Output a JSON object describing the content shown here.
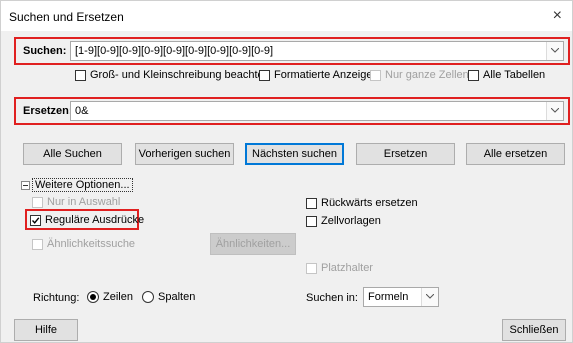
{
  "window": {
    "title": "Suchen und Ersetzen",
    "close_symbol": "×"
  },
  "search": {
    "label": "Suchen:",
    "value": "[1-9][0-9][0-9][0-9][0-9][0-9][0-9][0-9][0-9]"
  },
  "search_options": {
    "match_case": "Groß- und Kleinschreibung beachten",
    "formatted_display": "Formatierte Anzeige",
    "whole_cells": "Nur ganze Zellen",
    "all_sheets": "Alle Tabellen"
  },
  "replace": {
    "label": "Ersetzen:",
    "value": "0&"
  },
  "buttons": {
    "find_all": "Alle Suchen",
    "find_prev": "Vorherigen suchen",
    "find_next": "Nächsten suchen",
    "replace": "Ersetzen",
    "replace_all": "Alle ersetzen",
    "similarity_settings": "Ähnlichkeiten...",
    "help": "Hilfe",
    "close": "Schließen"
  },
  "more_options": {
    "toggle_label": "Weitere Optionen...",
    "current_selection": "Nur in Auswahl",
    "regex": "Reguläre Ausdrücke",
    "similarity": "Ähnlichkeitssuche",
    "backwards": "Rückwärts ersetzen",
    "cell_styles": "Zellvorlagen",
    "wildcards": "Platzhalter"
  },
  "direction": {
    "label": "Richtung:",
    "rows": "Zeilen",
    "columns": "Spalten",
    "selected": "Zeilen"
  },
  "search_in": {
    "label": "Suchen in:",
    "value": "Formeln"
  }
}
